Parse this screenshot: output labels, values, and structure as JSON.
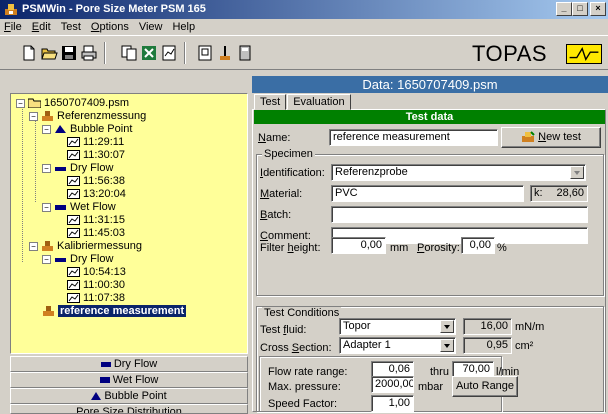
{
  "window": {
    "title": "PSMWin - Pore Size Meter PSM 165"
  },
  "menu": [
    {
      "label": "File",
      "u": "F",
      "rest": "ile"
    },
    {
      "label": "Edit",
      "u": "E",
      "rest": "dit"
    },
    {
      "label": "Test",
      "u": "",
      "rest": "Test"
    },
    {
      "label": "Options",
      "u": "O",
      "rest": "ptions"
    },
    {
      "label": "View",
      "u": "",
      "rest": "View"
    },
    {
      "label": "Help",
      "u": "",
      "rest": "Help"
    }
  ],
  "brand": {
    "logo_text": "TOPAS"
  },
  "data_header": "Data: 1650707409.psm",
  "tabs": {
    "test": "Test",
    "evaluation": "Evaluation"
  },
  "tree": {
    "root": "1650707409.psm",
    "referenzmessung": "Referenzmessung",
    "bubble_point": "Bubble Point",
    "bp_t1": "11:29:11",
    "bp_t2": "11:30:07",
    "dry_flow": "Dry Flow",
    "df_t1": "11:56:38",
    "df_t2": "13:20:04",
    "wet_flow": "Wet Flow",
    "wf_t1": "11:31:15",
    "wf_t2": "11:45:03",
    "kalibriermessung": "Kalibriermessung",
    "k_dry_flow": "Dry Flow",
    "k_t1": "10:54:13",
    "k_t2": "11:00:30",
    "k_t3": "11:07:38",
    "reference": "reference measurement"
  },
  "nav_buttons": {
    "dry_flow": "Dry Flow",
    "wet_flow": "Wet Flow",
    "bubble_point": "Bubble Point",
    "psd": "Pore Size Distribution"
  },
  "test_data": {
    "heading": "Test data",
    "name_label": "Name:",
    "name_value": "reference measurement",
    "new_test_button": "New test",
    "specimen_title": "Specimen",
    "identification_label": "Identification:",
    "identification_value": "Referenzprobe",
    "material_label": "Material:",
    "material_value": "PVC",
    "k_label": "k:",
    "k_value": "28,60",
    "batch_label": "Batch:",
    "batch_value": "",
    "comment_label": "Comment:",
    "comment_value": "",
    "filter_height_label": "Filter height:",
    "filter_height_value": "0,00",
    "filter_height_unit": "mm",
    "porosity_label": "Porosity:",
    "porosity_value": "0,00",
    "porosity_unit": "%"
  },
  "test_conditions": {
    "title": "Test Conditions",
    "fluid_label": "Test fluid:",
    "fluid_value": "Topor",
    "fluid_tension_value": "16,00",
    "fluid_tension_unit": "mN/m",
    "cross_section_label": "Cross Section:",
    "cross_section_value": "Adapter 1",
    "cross_section_area_value": "0,95",
    "cross_section_area_unit": "cm²",
    "flow_rate_label": "Flow rate range:",
    "flow_rate_from": "0,06",
    "flow_rate_thru": "thru",
    "flow_rate_to": "70,00",
    "flow_rate_unit": "l/min",
    "max_pressure_label": "Max. pressure:",
    "max_pressure_value": "2000,00",
    "max_pressure_unit": "mbar",
    "auto_range_button": "Auto Range",
    "speed_factor_label": "Speed Factor:",
    "speed_factor_value": "1,00"
  },
  "colors": {
    "title_bar": "#0a246a",
    "tree_background": "#ffff99",
    "data_header": "#3a6ea5",
    "test_data_bar": "#008000",
    "logo_yellow": "#ffe800"
  }
}
